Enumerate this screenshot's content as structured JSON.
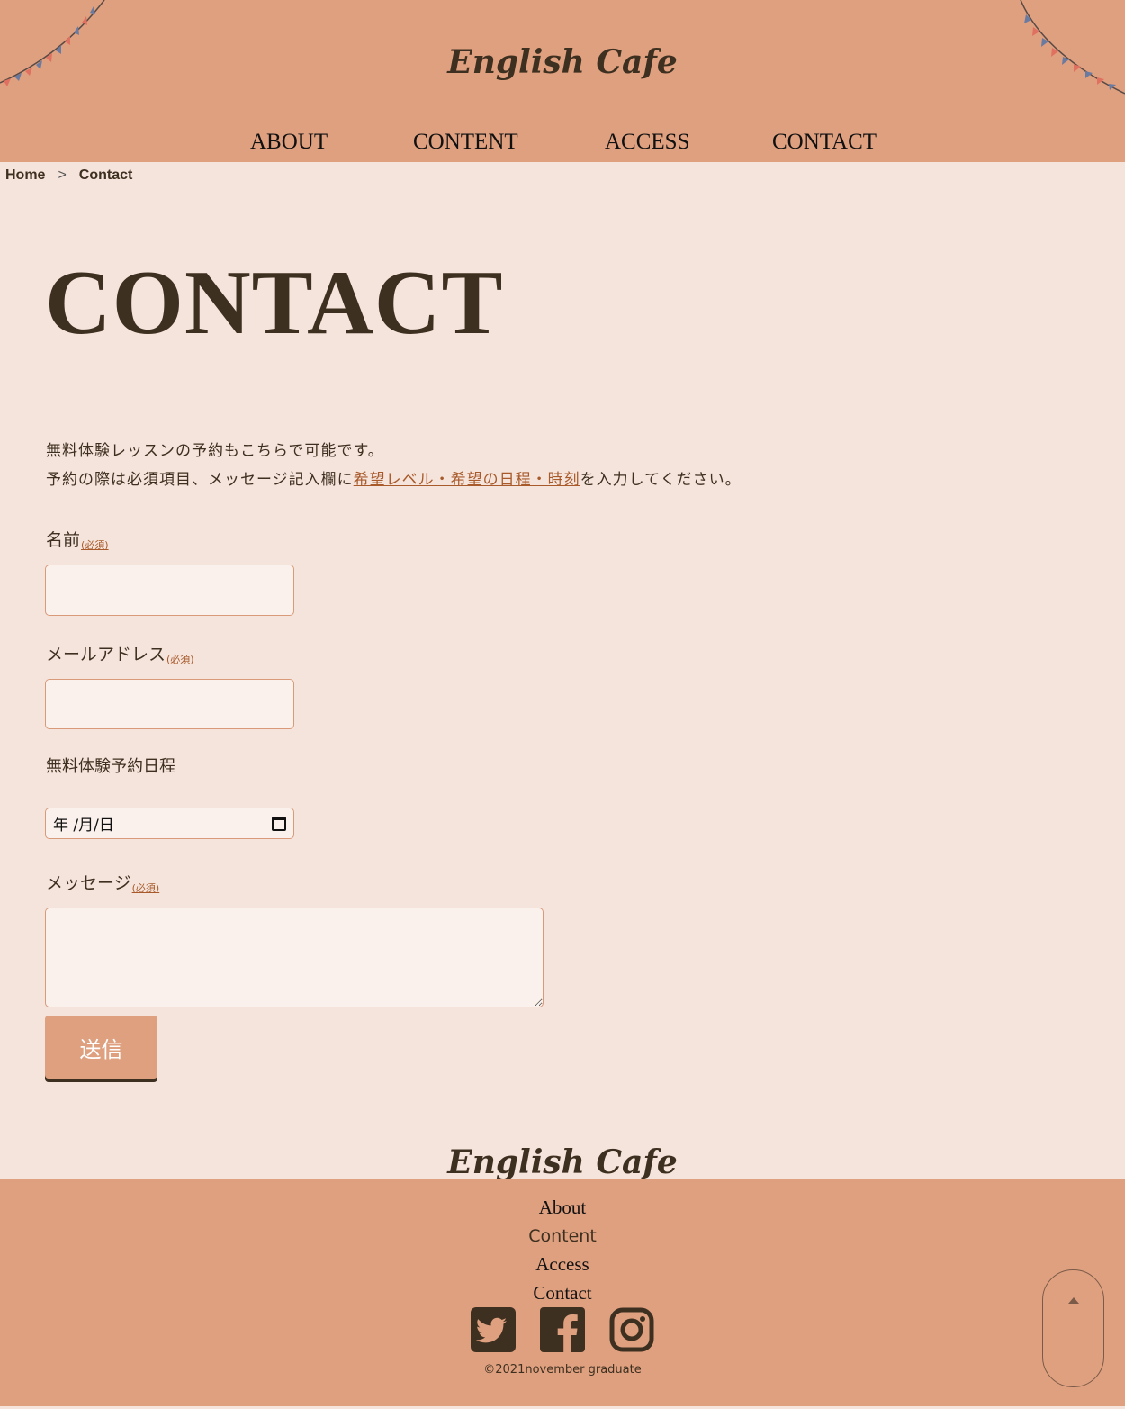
{
  "header": {
    "logo": "English Cafe",
    "nav": [
      {
        "label": "ABOUT"
      },
      {
        "label": "CONTENT"
      },
      {
        "label": "ACCESS"
      },
      {
        "label": "CONTACT"
      }
    ]
  },
  "breadcrumb": {
    "home": "Home",
    "separator": ">",
    "current": "Contact"
  },
  "main": {
    "title": "CONTACT",
    "intro_line1": "無料体験レッスンの予約もこちらで可能です。",
    "intro_line2_before": "予約の際は必須項目、メッセージ記入欄に",
    "intro_line2_link": "希望レベル・希望の日程・時刻",
    "intro_line2_after": "を入力してください。",
    "form": {
      "name_label": "名前",
      "email_label": "メールアドレス",
      "date_label": "無料体験予約日程",
      "message_label": "メッセージ",
      "required_mark": "(必須)",
      "name_value": "",
      "email_value": "",
      "date_value": "年 /月/日",
      "message_value": "",
      "submit_label": "送信"
    }
  },
  "footer": {
    "logo": "English Cafe",
    "links": [
      {
        "label": "About"
      },
      {
        "label": "Content"
      },
      {
        "label": "Access"
      },
      {
        "label": "Contact"
      }
    ],
    "social_icons": [
      "twitter-icon",
      "facebook-icon",
      "instagram-icon"
    ],
    "copyright": "©2021november graduate"
  },
  "colors": {
    "background": "#f5e4dc",
    "header_footer": "#dfa07f",
    "text": "#3e3020",
    "accent_link": "#a85a2a"
  }
}
